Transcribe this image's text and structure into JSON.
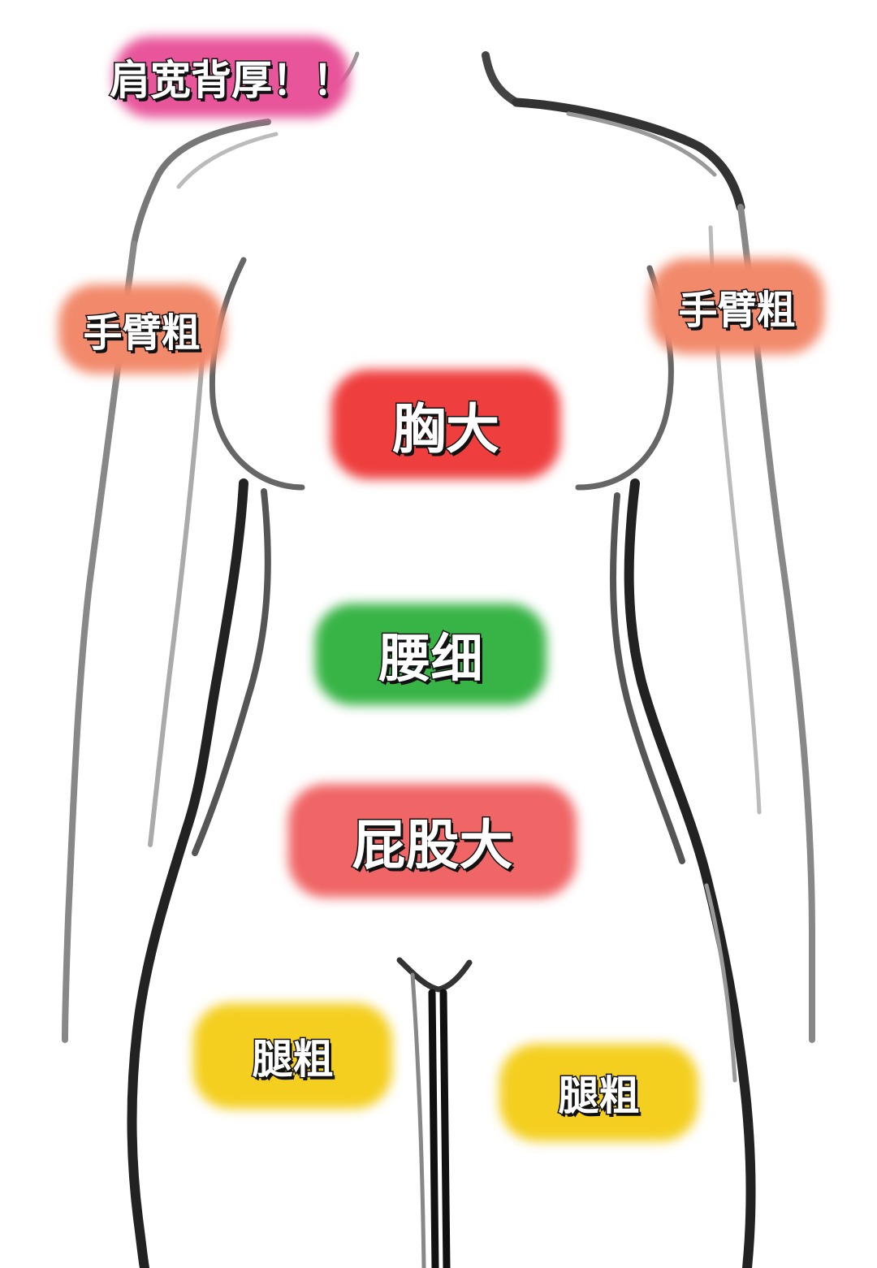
{
  "labels": {
    "shoulders": {
      "text": "肩宽背厚！！",
      "color": "#e8559a"
    },
    "arm_left": {
      "text": "手臂粗",
      "color": "#f2896b"
    },
    "arm_right": {
      "text": "手臂粗",
      "color": "#f2896b"
    },
    "chest": {
      "text": "胸大",
      "color": "#ef3e3e"
    },
    "waist": {
      "text": "腰细",
      "color": "#38b446"
    },
    "hips": {
      "text": "屁股大",
      "color": "#f06565"
    },
    "thigh_left": {
      "text": "腿粗",
      "color": "#f4cf1f"
    },
    "thigh_right": {
      "text": "腿粗",
      "color": "#f4cf1f"
    }
  }
}
